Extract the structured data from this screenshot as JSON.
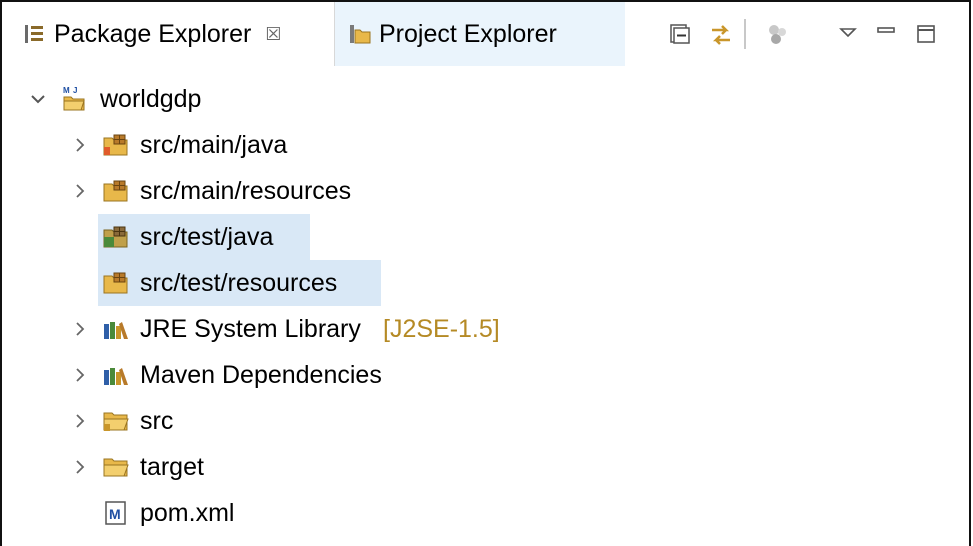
{
  "tabs": {
    "package_explorer": {
      "label": "Package Explorer",
      "close": "☒"
    },
    "project_explorer": {
      "label": "Project Explorer"
    }
  },
  "tree": {
    "project": {
      "label": "worldgdp",
      "badge": "M J"
    },
    "items": [
      {
        "label": "src/main/java"
      },
      {
        "label": "src/main/resources"
      },
      {
        "label": "src/test/java"
      },
      {
        "label": "src/test/resources"
      },
      {
        "label": "JRE System Library",
        "decoration": "[J2SE-1.5]"
      },
      {
        "label": "Maven Dependencies"
      },
      {
        "label": "src"
      },
      {
        "label": "target"
      },
      {
        "label": "pom.xml",
        "icon_letter": "M"
      }
    ]
  },
  "colors": {
    "selection": "#d9e8f6",
    "inactive_tab": "#eaf4fc",
    "decoration": "#b58a25"
  }
}
